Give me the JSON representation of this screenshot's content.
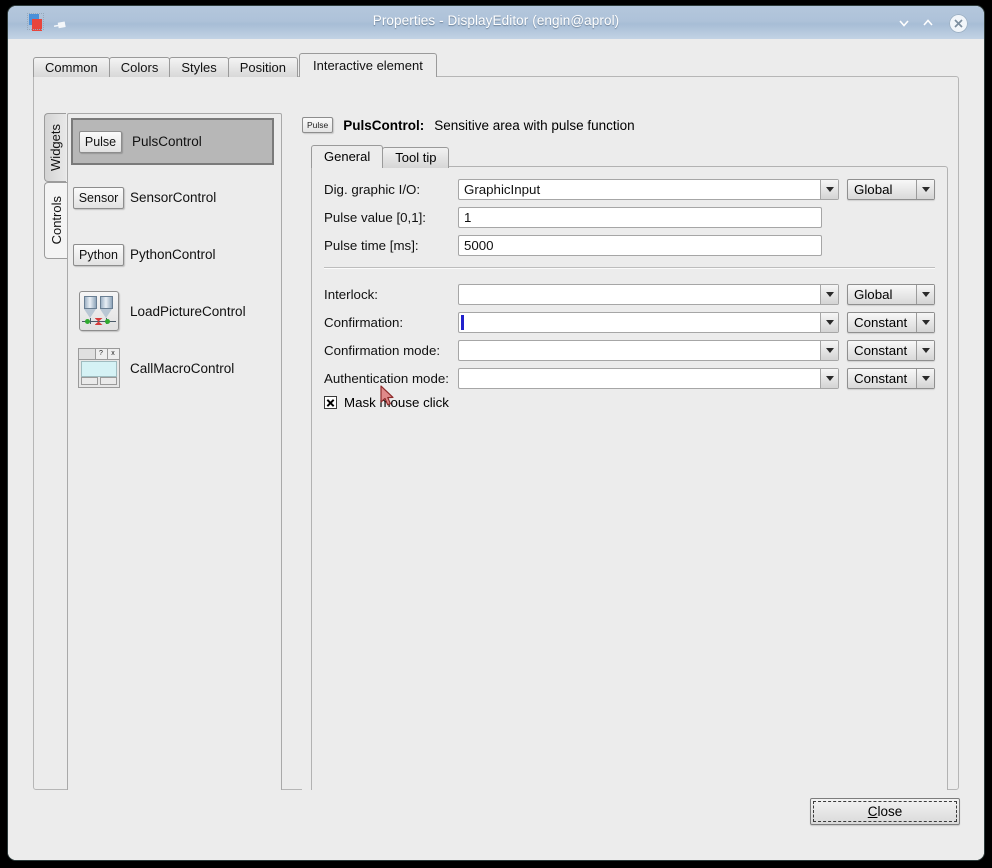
{
  "window": {
    "title": "Properties - DisplayEditor (engin@aprol)",
    "app_icon": "app-window-icon",
    "pin_icon": "pin-icon",
    "minimize_icon": "chevron-down-icon",
    "maximize_icon": "chevron-up-icon",
    "close_icon": "close-x-icon",
    "titlebar_color": "#aec2d9",
    "background_color": "#ececec"
  },
  "outer_tabs": [
    {
      "label": "Common",
      "active": false
    },
    {
      "label": "Colors",
      "active": false
    },
    {
      "label": "Styles",
      "active": false
    },
    {
      "label": "Position",
      "active": false
    },
    {
      "label": "Interactive element",
      "active": true
    }
  ],
  "vertical_tabs": [
    {
      "label": "Widgets",
      "active": false
    },
    {
      "label": "Controls",
      "active": true
    }
  ],
  "widget_list": [
    {
      "icon": "pulse-tag-icon",
      "icon_text": "Pulse",
      "label": "PulsControl",
      "selected": true
    },
    {
      "icon": "sensor-tag-icon",
      "icon_text": "Sensor",
      "label": "SensorControl",
      "selected": false
    },
    {
      "icon": "python-tag-icon",
      "icon_text": "Python",
      "label": "PythonControl",
      "selected": false
    },
    {
      "icon": "load-picture-icon",
      "icon_text": "",
      "label": "LoadPictureControl",
      "selected": false
    },
    {
      "icon": "call-macro-icon",
      "icon_text": "",
      "label": "CallMacroControl",
      "selected": false
    }
  ],
  "detail": {
    "header": {
      "tag": "Pulse",
      "name": "PulsControl:",
      "description": "Sensitive area with pulse function"
    },
    "inner_tabs": [
      {
        "label": "General",
        "active": true
      },
      {
        "label": "Tool tip",
        "active": false
      }
    ],
    "fields_group_1": [
      {
        "label": "Dig. graphic I/O:",
        "type": "combo",
        "value": "GraphicInput",
        "placeholder": "",
        "scope": "Global",
        "has_scope": true,
        "caret": false
      },
      {
        "label": "Pulse value [0,1]:",
        "type": "text",
        "value": "1",
        "placeholder": "",
        "scope": "",
        "has_scope": false,
        "caret": false
      },
      {
        "label": "Pulse time [ms]:",
        "type": "text",
        "value": "5000",
        "placeholder": "",
        "scope": "",
        "has_scope": false,
        "caret": false
      }
    ],
    "fields_group_2": [
      {
        "label": "Interlock:",
        "type": "combo",
        "value": "",
        "placeholder": "",
        "scope": "Global",
        "has_scope": true,
        "caret": false
      },
      {
        "label": "Confirmation:",
        "type": "combo",
        "value": "",
        "placeholder": "",
        "scope": "Constant",
        "has_scope": true,
        "caret": true
      },
      {
        "label": "Confirmation mode:",
        "type": "combo",
        "value": "",
        "placeholder": "",
        "scope": "Constant",
        "has_scope": true,
        "caret": false
      },
      {
        "label": "Authentication mode:",
        "type": "combo",
        "value": "",
        "placeholder": "",
        "scope": "Constant",
        "has_scope": true,
        "caret": false
      }
    ],
    "checkbox": {
      "label": "Mask mouse click",
      "checked": true
    }
  },
  "footer": {
    "close_label": "Close",
    "close_mnemonic": "C"
  }
}
